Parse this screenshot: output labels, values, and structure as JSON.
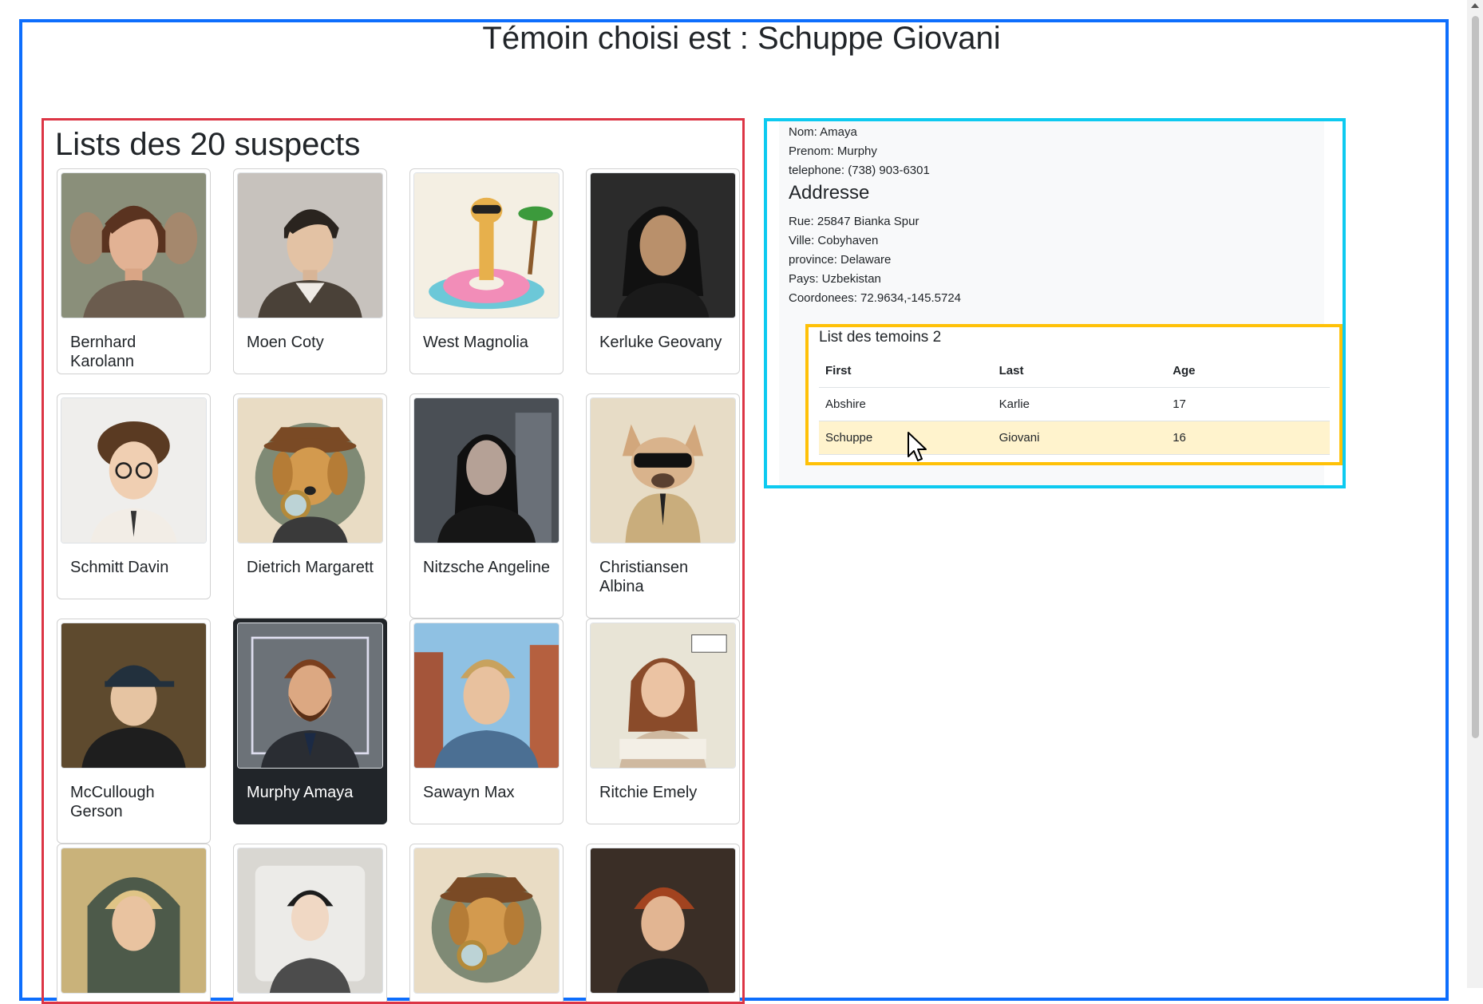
{
  "header": {
    "title": "Témoin choisi est : Schuppe Giovani"
  },
  "suspects": {
    "title": "Lists des 20 suspects",
    "cards": [
      {
        "name": "Bernhard Karolann",
        "image": "portrait-woman-brown-hair-icon"
      },
      {
        "name": "Moen Coty",
        "image": "portrait-young-man-hoodie-icon"
      },
      {
        "name": "West Magnolia",
        "image": "giraffe-donut-float-icon"
      },
      {
        "name": "Kerluke Geovany",
        "image": "portrait-man-long-black-hair-icon"
      },
      {
        "name": "Schmitt Davin",
        "image": "portrait-curly-boy-glasses-icon"
      },
      {
        "name": "Dietrich Margarett",
        "image": "detective-dog-magnifier-icon"
      },
      {
        "name": "Nitzsche Angeline",
        "image": "portrait-man-dark-coat-icon"
      },
      {
        "name": "Christiansen Albina",
        "image": "french-bulldog-sunglasses-icon"
      },
      {
        "name": "McCullough Gerson",
        "image": "portrait-boy-cap-icon"
      },
      {
        "name": "Murphy Amaya",
        "image": "portrait-bearded-man-suit-icon",
        "selected": true
      },
      {
        "name": "Sawayn Max",
        "image": "portrait-blond-man-street-icon"
      },
      {
        "name": "Ritchie Emely",
        "image": "portrait-woman-auburn-hair-icon"
      },
      {
        "name": "",
        "image": "portrait-blonde-hood-icon"
      },
      {
        "name": "",
        "image": "portrait-faceless-black-hair-icon"
      },
      {
        "name": "",
        "image": "detective-dog-magnifier-icon"
      },
      {
        "name": "",
        "image": "portrait-red-hair-man-icon"
      }
    ]
  },
  "witness": {
    "nom": "Nom: Amaya",
    "prenom": "Prenom: Murphy",
    "telephone": "telephone: (738) 903-6301",
    "address_heading": "Addresse",
    "rue": "Rue: 25847 Bianka Spur",
    "ville": "Ville: Cobyhaven",
    "province": "province: Delaware",
    "pays": "Pays: Uzbekistan",
    "coords": "Coordonees: 72.9634,-145.5724",
    "table": {
      "title": "List des temoins 2",
      "headers": [
        "First",
        "Last",
        "Age"
      ],
      "rows": [
        [
          "Abshire",
          "Karlie",
          "17"
        ],
        [
          "Schuppe",
          "Giovani",
          "16"
        ]
      ]
    }
  },
  "colors": {
    "outer_border": "#0d6efd",
    "suspects_border": "#dc3545",
    "witness_border": "#0dcaf0",
    "table_border": "#ffc107",
    "selected_card": "#212529",
    "highlight_row": "#fff3cd"
  }
}
